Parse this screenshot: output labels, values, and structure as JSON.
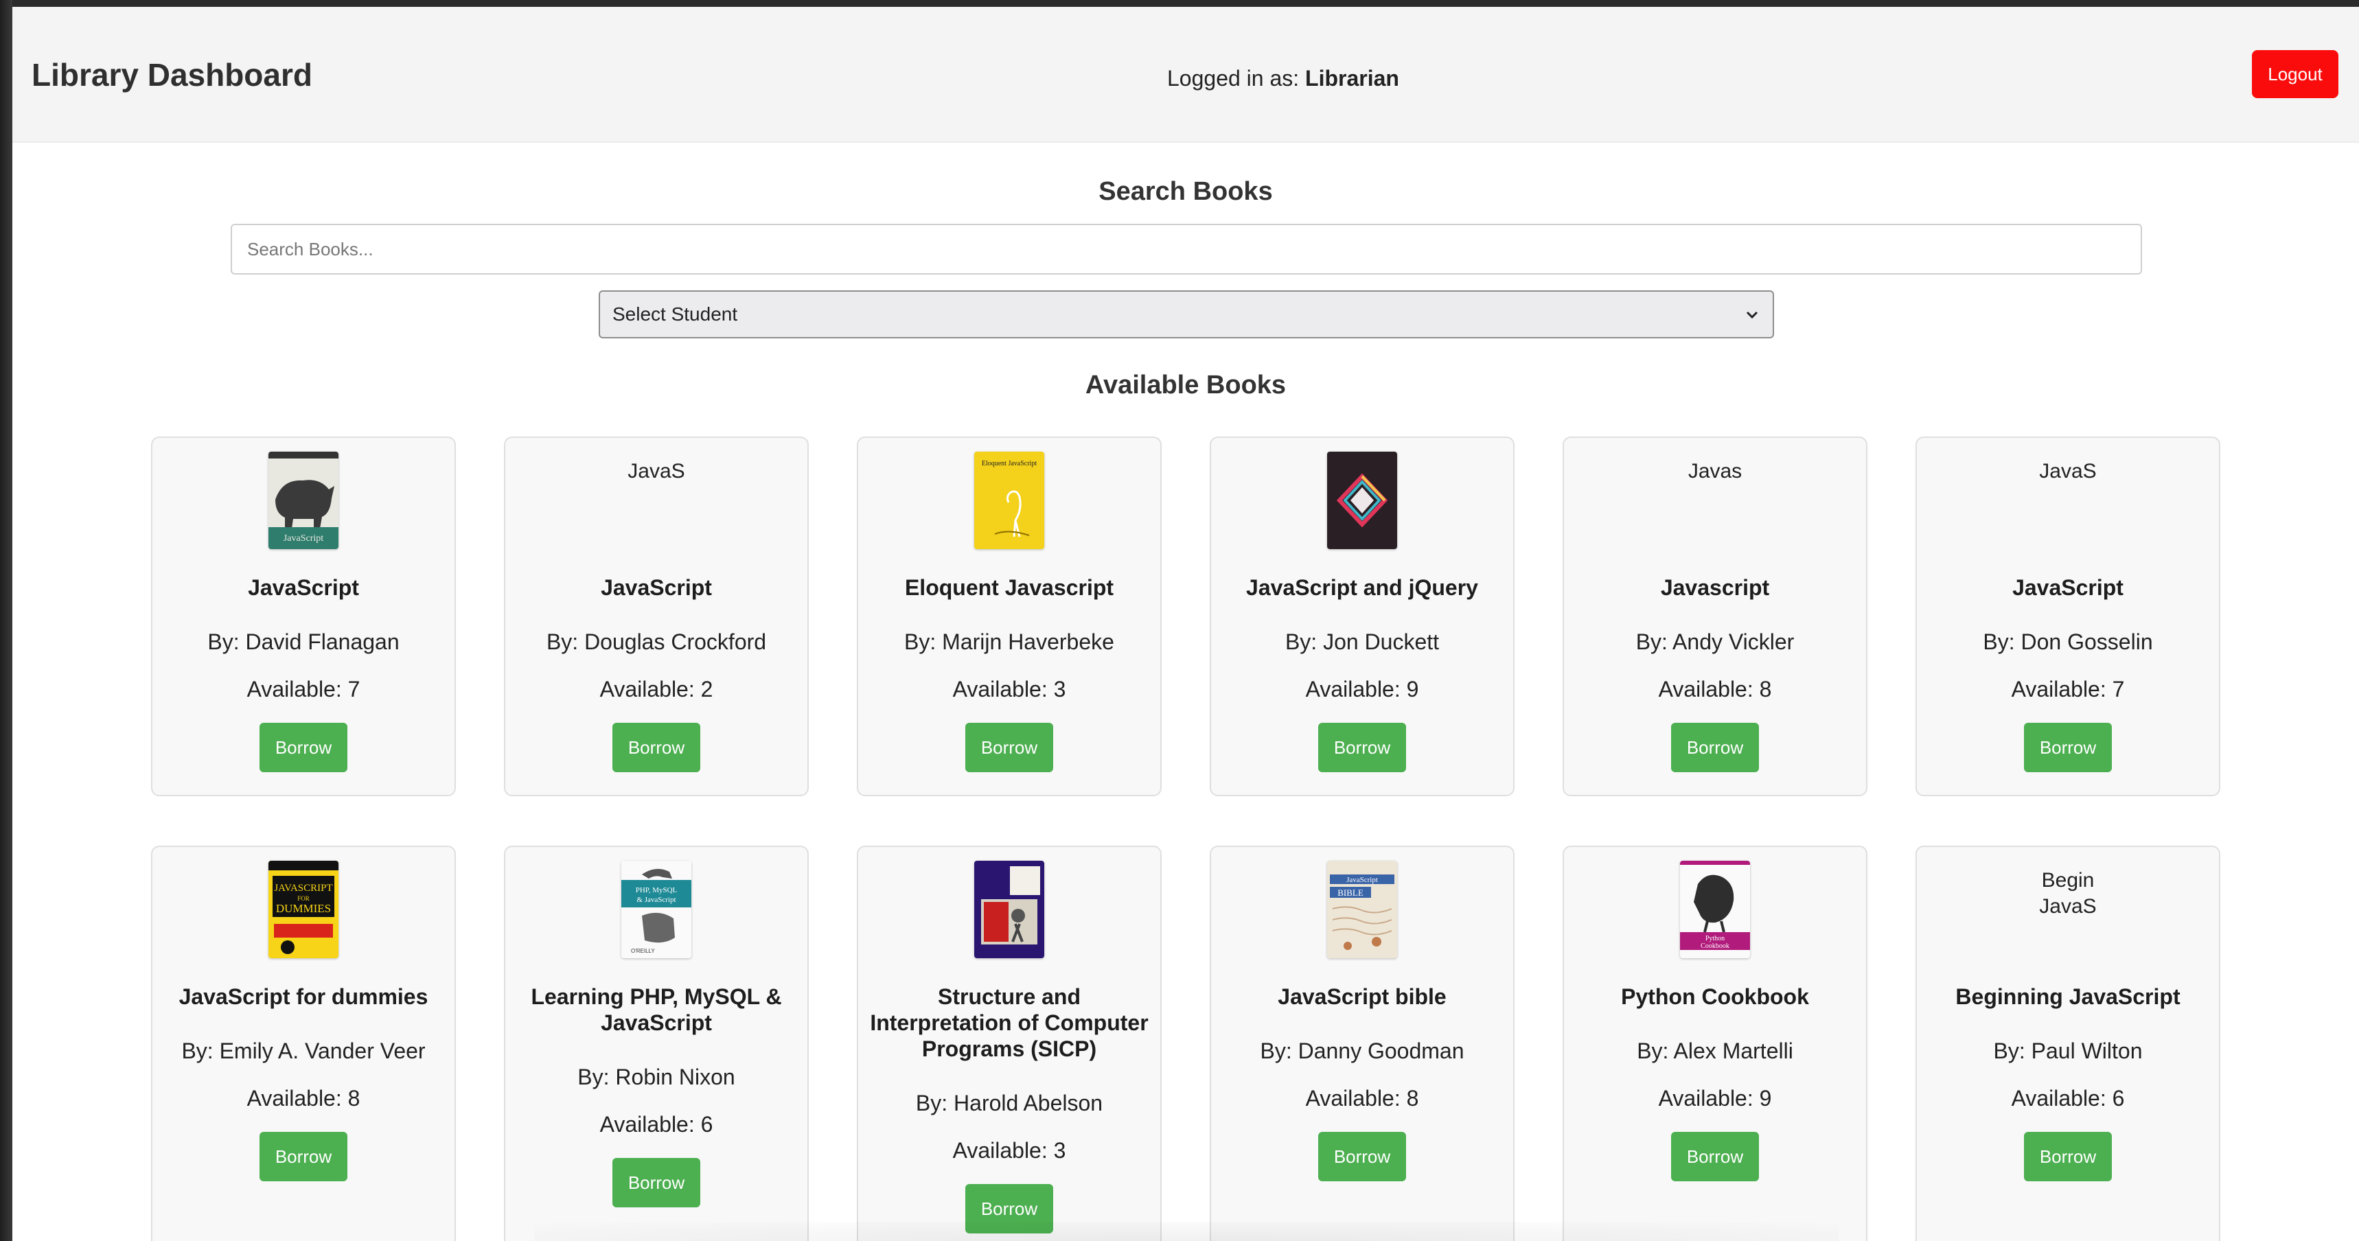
{
  "header": {
    "title": "Library Dashboard",
    "logged_in_prefix": "Logged in as: ",
    "logged_in_user": "Librarian",
    "logout_label": "Logout"
  },
  "search": {
    "title": "Search Books",
    "placeholder": "Search Books...",
    "student_select_value": "Select Student"
  },
  "books_section": {
    "title": "Available Books",
    "borrow_label": "Borrow",
    "author_prefix": "By: ",
    "available_prefix": "Available: "
  },
  "colors": {
    "logout": "#fb0c0c",
    "borrow": "#4caf50",
    "header_bg": "#f4f4f4",
    "card_bg": "#f8f8f8"
  },
  "books": [
    {
      "title": "JavaScript",
      "author": "David Flanagan",
      "available": "7",
      "cover": "rhino-cover"
    },
    {
      "title": "JavaScript",
      "author": "Douglas Crockford",
      "available": "2",
      "cover_alt": "JavaS"
    },
    {
      "title": "Eloquent Javascript",
      "author": "Marijn Haverbeke",
      "available": "3",
      "cover": "yellow-bird-cover"
    },
    {
      "title": "JavaScript and jQuery",
      "author": "Jon Duckett",
      "available": "9",
      "cover": "dark-diamond-cover"
    },
    {
      "title": "Javascript",
      "author": "Andy Vickler",
      "available": "8",
      "cover_alt": "Javas"
    },
    {
      "title": "JavaScript",
      "author": "Don Gosselin",
      "available": "7",
      "cover_alt": "JavaS"
    },
    {
      "title": "JavaScript for dummies",
      "author": "Emily A. Vander Veer",
      "available": "8",
      "cover": "dummies-cover"
    },
    {
      "title": "Learning PHP, MySQL & JavaScript",
      "author": "Robin Nixon",
      "available": "6",
      "cover": "oreilly-php-cover"
    },
    {
      "title": "Structure and Interpretation of Computer Programs (SICP)",
      "author": "Harold Abelson",
      "available": "3",
      "cover": "sicp-cover"
    },
    {
      "title": "JavaScript bible",
      "author": "Danny Goodman",
      "available": "8",
      "cover": "bible-cover"
    },
    {
      "title": "Python Cookbook",
      "author": "Alex Martelli",
      "available": "9",
      "cover": "python-cookbook-cover"
    },
    {
      "title": "Beginning JavaScript",
      "author": "Paul Wilton",
      "available": "6",
      "cover_alt": "Begin JavaS"
    }
  ]
}
